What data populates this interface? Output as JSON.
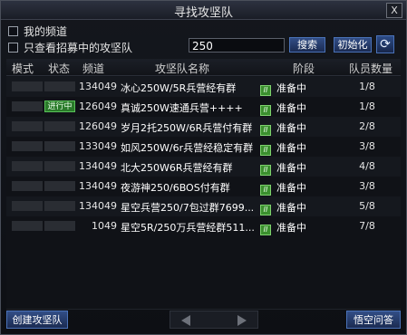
{
  "window": {
    "title": "寻找攻坚队",
    "close_label": "X"
  },
  "filters": {
    "my_channel_label": "我的频道",
    "only_recruiting_label": "只查看招募中的攻坚队"
  },
  "search": {
    "value": "250",
    "search_button": "搜索",
    "reset_button": "初始化"
  },
  "table": {
    "headers": [
      "模式",
      "状态",
      "频道",
      "攻坚队名称",
      "阶段",
      "队员数量"
    ],
    "rows": [
      {
        "status": "",
        "channel": "134049",
        "name": "冰心250W/5R兵营经有群",
        "stage": "准备中",
        "members": "1/8"
      },
      {
        "status": "进行中",
        "channel": "126049",
        "name": "真诚250W速通兵营++++",
        "stage": "准备中",
        "members": "1/8"
      },
      {
        "status": "",
        "channel": "126049",
        "name": "岁月2托250W/6R兵营付有群",
        "stage": "准备中",
        "members": "2/8"
      },
      {
        "status": "",
        "channel": "133049",
        "name": "如风250W/6r兵营经稳定有群",
        "stage": "准备中",
        "members": "3/8"
      },
      {
        "status": "",
        "channel": "134049",
        "name": "北大250W6R兵营经有群",
        "stage": "准备中",
        "members": "4/8"
      },
      {
        "status": "",
        "channel": "134049",
        "name": "夜游神250/6BOS付有群",
        "stage": "准备中",
        "members": "3/8"
      },
      {
        "status": "",
        "channel": "134049",
        "name": "星空兵营250/7包过群7699...",
        "stage": "准备中",
        "members": "5/8"
      },
      {
        "status": "",
        "channel": "1049",
        "name": "星空5R/250万兵营经群511...",
        "stage": "准备中",
        "members": "7/8"
      }
    ]
  },
  "footer": {
    "create_button": "创建攻坚队",
    "join_button": "悟空问答"
  }
}
